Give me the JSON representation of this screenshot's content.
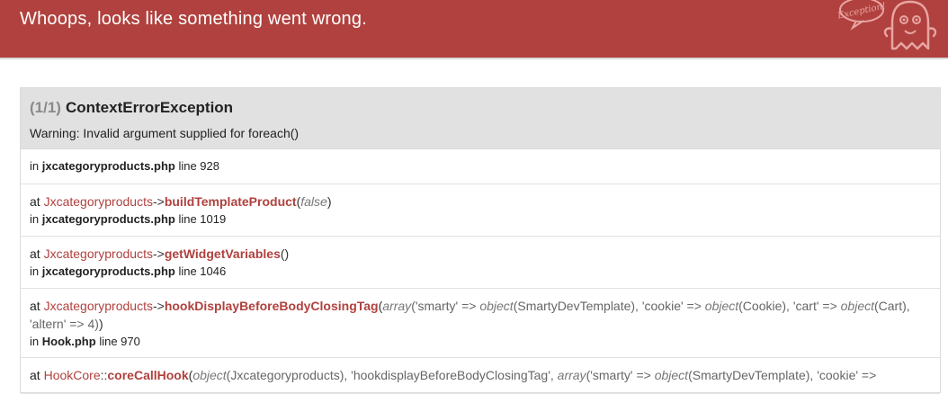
{
  "header": {
    "title": "Whoops, looks like something went wrong.",
    "logo_text": "Exception!",
    "bg_color": "#b0413e"
  },
  "exception": {
    "count": "(1/1)",
    "name": "ContextErrorException",
    "message": "Warning: Invalid argument supplied for foreach()"
  },
  "trace": [
    {
      "in_label": "in",
      "file": "jxcategoryproducts.php",
      "line_label": "line 928"
    },
    {
      "at_label": "at",
      "class": "Jxcategoryproducts",
      "op": "->",
      "method": "buildTemplateProduct",
      "open": "(",
      "args": "false",
      "close": ")",
      "in_label": "in",
      "file": "jxcategoryproducts.php",
      "line_label": "line 1019"
    },
    {
      "at_label": "at",
      "class": "Jxcategoryproducts",
      "op": "->",
      "method": "getWidgetVariables",
      "open": "(",
      "close": ")",
      "in_label": "in",
      "file": "jxcategoryproducts.php",
      "line_label": "line 1046"
    },
    {
      "at_label": "at",
      "class": "Jxcategoryproducts",
      "op": "->",
      "method": "hookDisplayBeforeBodyClosingTag",
      "open": "(",
      "arg_kw1": "array",
      "arg_txt1": "('smarty' => ",
      "arg_kw2": "object",
      "arg_txt2": "(SmartyDevTemplate), 'cookie' => ",
      "arg_kw3": "object",
      "arg_txt3": "(Cookie), 'cart' => ",
      "arg_kw4": "object",
      "arg_txt4": "(Cart), 'altern' => 4)",
      "close": ")",
      "in_label": "in",
      "file": "Hook.php",
      "line_label": "line 970"
    },
    {
      "at_label": "at",
      "class": "HookCore",
      "op": "::",
      "method": "coreCallHook",
      "open": "(",
      "arg_kw1": "object",
      "arg_txt1": "(Jxcategoryproducts), 'hookdisplayBeforeBodyClosingTag', ",
      "arg_kw2": "array",
      "arg_txt2": "('smarty' => ",
      "arg_kw3": "object",
      "arg_txt3": "(SmartyDevTemplate), 'cookie' =>"
    }
  ]
}
